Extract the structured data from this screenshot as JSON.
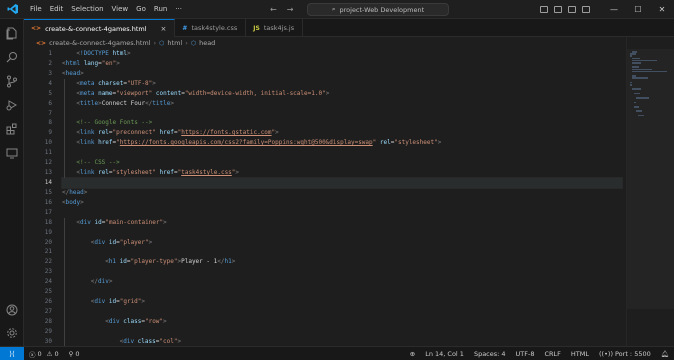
{
  "menu": [
    "File",
    "Edit",
    "Selection",
    "View",
    "Go",
    "Run"
  ],
  "search": {
    "label": "project-Web Development"
  },
  "tabs": [
    {
      "label": "create-&-connect-4games.html",
      "icon": "<>",
      "active": true,
      "icon_color": "#e37933"
    },
    {
      "label": "task4style.css",
      "icon": "#",
      "active": false,
      "icon_color": "#42a5f5"
    },
    {
      "label": "task4js.js",
      "icon": "JS",
      "active": false,
      "icon_color": "#cbcb41"
    }
  ],
  "breadcrumb": {
    "file": "create-&-connect-4games.html",
    "items": [
      "html",
      "head"
    ]
  },
  "editor": {
    "current_line": 14,
    "lines": [
      {
        "n": "1",
        "indent": 4,
        "tokens": [
          [
            "br",
            "<"
          ],
          [
            "tag",
            "!DOCTYPE"
          ],
          [
            "attr",
            " html"
          ],
          [
            "br",
            ">"
          ]
        ]
      },
      {
        "n": "2",
        "indent": 0,
        "tokens": [
          [
            "br",
            "<"
          ],
          [
            "tag",
            "html"
          ],
          [
            "attr",
            " lang"
          ],
          [
            "txt",
            "="
          ],
          [
            "str",
            "\"en\""
          ],
          [
            "br",
            ">"
          ]
        ]
      },
      {
        "n": "3",
        "indent": 0,
        "tokens": [
          [
            "br",
            "<"
          ],
          [
            "tag",
            "head"
          ],
          [
            "br",
            ">"
          ]
        ]
      },
      {
        "n": "4",
        "indent": 4,
        "tokens": [
          [
            "br",
            "<"
          ],
          [
            "tag",
            "meta"
          ],
          [
            "attr",
            " charset"
          ],
          [
            "txt",
            "="
          ],
          [
            "str",
            "\"UTF-8\""
          ],
          [
            "br",
            ">"
          ]
        ]
      },
      {
        "n": "5",
        "indent": 4,
        "tokens": [
          [
            "br",
            "<"
          ],
          [
            "tag",
            "meta"
          ],
          [
            "attr",
            " name"
          ],
          [
            "txt",
            "="
          ],
          [
            "str",
            "\"viewport\""
          ],
          [
            "attr",
            " content"
          ],
          [
            "txt",
            "="
          ],
          [
            "str",
            "\"width=device-width, initial-scale=1.0\""
          ],
          [
            "br",
            ">"
          ]
        ]
      },
      {
        "n": "6",
        "indent": 4,
        "tokens": [
          [
            "br",
            "<"
          ],
          [
            "tag",
            "title"
          ],
          [
            "br",
            ">"
          ],
          [
            "txt",
            "Connect Four"
          ],
          [
            "br",
            "</"
          ],
          [
            "tag",
            "title"
          ],
          [
            "br",
            ">"
          ]
        ]
      },
      {
        "n": "7",
        "indent": 0,
        "tokens": []
      },
      {
        "n": "8",
        "indent": 4,
        "tokens": [
          [
            "cmt",
            "<!-- Google Fonts -->"
          ]
        ]
      },
      {
        "n": "9",
        "indent": 4,
        "tokens": [
          [
            "br",
            "<"
          ],
          [
            "tag",
            "link"
          ],
          [
            "attr",
            " rel"
          ],
          [
            "txt",
            "="
          ],
          [
            "str",
            "\"preconnect\""
          ],
          [
            "attr",
            " href"
          ],
          [
            "txt",
            "="
          ],
          [
            "str",
            "\""
          ],
          [
            "link",
            "https://fonts.gstatic.com"
          ],
          [
            "str",
            "\""
          ],
          [
            "br",
            ">"
          ]
        ]
      },
      {
        "n": "10",
        "indent": 4,
        "tokens": [
          [
            "br",
            "<"
          ],
          [
            "tag",
            "link"
          ],
          [
            "attr",
            " href"
          ],
          [
            "txt",
            "="
          ],
          [
            "str",
            "\""
          ],
          [
            "link",
            "https://fonts.googleapis.com/css2?family=Poppins:wght@500&display=swap"
          ],
          [
            "str",
            "\""
          ],
          [
            "attr",
            " rel"
          ],
          [
            "txt",
            "="
          ],
          [
            "str",
            "\"stylesheet\""
          ],
          [
            "br",
            ">"
          ]
        ]
      },
      {
        "n": "11",
        "indent": 0,
        "tokens": []
      },
      {
        "n": "12",
        "indent": 4,
        "tokens": [
          [
            "cmt",
            "<!-- CSS -->"
          ]
        ]
      },
      {
        "n": "13",
        "indent": 4,
        "tokens": [
          [
            "br",
            "<"
          ],
          [
            "tag",
            "link"
          ],
          [
            "attr",
            " rel"
          ],
          [
            "txt",
            "="
          ],
          [
            "str",
            "\"stylesheet\""
          ],
          [
            "attr",
            " href"
          ],
          [
            "txt",
            "="
          ],
          [
            "str",
            "\""
          ],
          [
            "link",
            "task4style.css"
          ],
          [
            "str",
            "\""
          ],
          [
            "br",
            ">"
          ]
        ]
      },
      {
        "n": "14",
        "indent": 0,
        "tokens": []
      },
      {
        "n": "15",
        "indent": 0,
        "tokens": [
          [
            "br",
            "</"
          ],
          [
            "tag",
            "head"
          ],
          [
            "br",
            ">"
          ]
        ]
      },
      {
        "n": "16",
        "indent": 0,
        "tokens": [
          [
            "br",
            "<"
          ],
          [
            "tag",
            "body"
          ],
          [
            "br",
            ">"
          ]
        ]
      },
      {
        "n": "17",
        "indent": 0,
        "tokens": []
      },
      {
        "n": "18",
        "indent": 4,
        "tokens": [
          [
            "br",
            "<"
          ],
          [
            "tag",
            "div"
          ],
          [
            "attr",
            " id"
          ],
          [
            "txt",
            "="
          ],
          [
            "str",
            "\"main-container\""
          ],
          [
            "br",
            ">"
          ]
        ]
      },
      {
        "n": "19",
        "indent": 0,
        "tokens": []
      },
      {
        "n": "20",
        "indent": 8,
        "tokens": [
          [
            "br",
            "<"
          ],
          [
            "tag",
            "div"
          ],
          [
            "attr",
            " id"
          ],
          [
            "txt",
            "="
          ],
          [
            "str",
            "\"player\""
          ],
          [
            "br",
            ">"
          ]
        ]
      },
      {
        "n": "21",
        "indent": 0,
        "tokens": []
      },
      {
        "n": "22",
        "indent": 12,
        "tokens": [
          [
            "br",
            "<"
          ],
          [
            "tag",
            "h1"
          ],
          [
            "attr",
            " id"
          ],
          [
            "txt",
            "="
          ],
          [
            "str",
            "\"player-type\""
          ],
          [
            "br",
            ">"
          ],
          [
            "txt",
            "Player - 1"
          ],
          [
            "br",
            "</"
          ],
          [
            "tag",
            "h1"
          ],
          [
            "br",
            ">"
          ]
        ]
      },
      {
        "n": "23",
        "indent": 0,
        "tokens": []
      },
      {
        "n": "24",
        "indent": 8,
        "tokens": [
          [
            "br",
            "</"
          ],
          [
            "tag",
            "div"
          ],
          [
            "br",
            ">"
          ]
        ]
      },
      {
        "n": "25",
        "indent": 0,
        "tokens": []
      },
      {
        "n": "26",
        "indent": 8,
        "tokens": [
          [
            "br",
            "<"
          ],
          [
            "tag",
            "div"
          ],
          [
            "attr",
            " id"
          ],
          [
            "txt",
            "="
          ],
          [
            "str",
            "\"grid\""
          ],
          [
            "br",
            ">"
          ]
        ]
      },
      {
        "n": "27",
        "indent": 0,
        "tokens": []
      },
      {
        "n": "28",
        "indent": 12,
        "tokens": [
          [
            "br",
            "<"
          ],
          [
            "tag",
            "div"
          ],
          [
            "attr",
            " class"
          ],
          [
            "txt",
            "="
          ],
          [
            "str",
            "\"row\""
          ],
          [
            "br",
            ">"
          ]
        ]
      },
      {
        "n": "29",
        "indent": 0,
        "tokens": []
      },
      {
        "n": "30",
        "indent": 16,
        "tokens": [
          [
            "br",
            "<"
          ],
          [
            "tag",
            "div"
          ],
          [
            "attr",
            " class"
          ],
          [
            "txt",
            "="
          ],
          [
            "str",
            "\"col\""
          ],
          [
            "br",
            ">"
          ]
        ]
      }
    ]
  },
  "status": {
    "errors": "0",
    "warnings": "0",
    "info": "0",
    "position": "Ln 14, Col 1",
    "spaces": "Spaces: 4",
    "encoding": "UTF-8",
    "eol": "CRLF",
    "language": "HTML",
    "port": "Port : 5500"
  },
  "colors": {
    "accent": "#0078d4",
    "background": "#1e1e1e"
  }
}
